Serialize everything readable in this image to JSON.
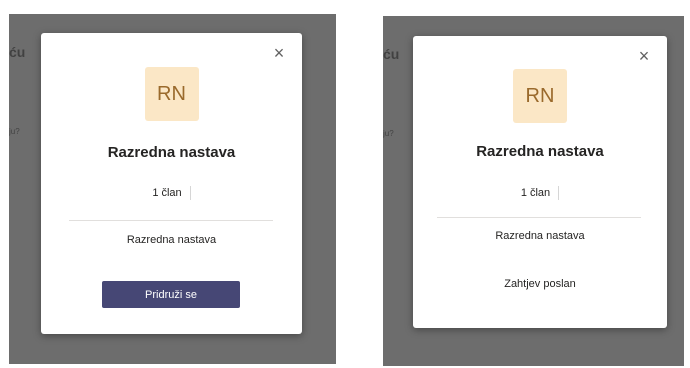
{
  "background": {
    "heading_fragment": "ću",
    "small_fragment": "ju?"
  },
  "dialog": {
    "avatar_initials": "RN",
    "team_name": "Razredna nastava",
    "member_count": "1 član",
    "description": "Razredna nastava",
    "close_glyph": "×"
  },
  "left": {
    "join_button_label": "Pridruži se"
  },
  "right": {
    "status_text": "Zahtjev poslan"
  },
  "colors": {
    "overlay": "#6d6d6d",
    "avatar_bg": "#fbe7c6",
    "avatar_text": "#9a6a2c",
    "button_bg": "#464775"
  }
}
